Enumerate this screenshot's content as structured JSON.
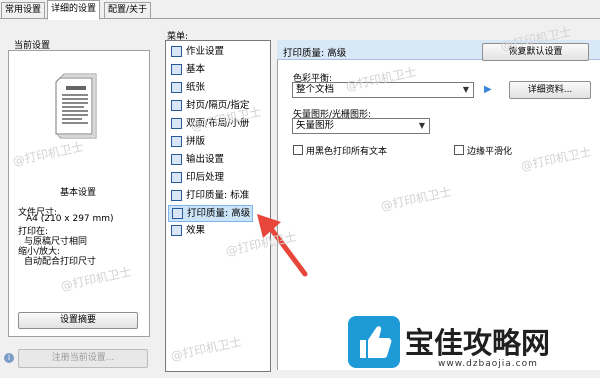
{
  "tabs": [
    "常用设置",
    "详细的设置",
    "配置/关于"
  ],
  "left": {
    "title": "当前设置",
    "preview_title": "基本设置",
    "info": [
      "文件尺寸:",
      "A4 (210 x 297 mm)",
      "打印在:",
      "与原稿尺寸相同",
      "缩小/放大:",
      "自动配合打印尺寸"
    ],
    "settings_button": "设置摘要",
    "register_button": "注册当前设置..."
  },
  "menu": {
    "label": "菜单:",
    "items": [
      "作业设置",
      "基本",
      "纸张",
      "封页/隔页/指定",
      "双面/布局/小册",
      "拼版",
      "输出设置",
      "印后处理",
      "打印质量: 标准",
      "打印质量: 高级",
      "效果"
    ],
    "selected_index": 9
  },
  "right": {
    "header": "打印质量: 高级",
    "restore_button": "恢复默认设置",
    "color_balance_label": "色彩平衡:",
    "color_balance_value": "整个文档",
    "details_button": "详细资料...",
    "vector_label": "矢量图形/光栅图形:",
    "vector_value": "矢量图形",
    "black_print_label": "用黑色打印所有文本",
    "edge_smooth_label": "边缘平滑化"
  },
  "watermark": "@打印机卫士",
  "logo": {
    "name": "宝佳攻略网",
    "url": "www.dzbaojia.com"
  }
}
